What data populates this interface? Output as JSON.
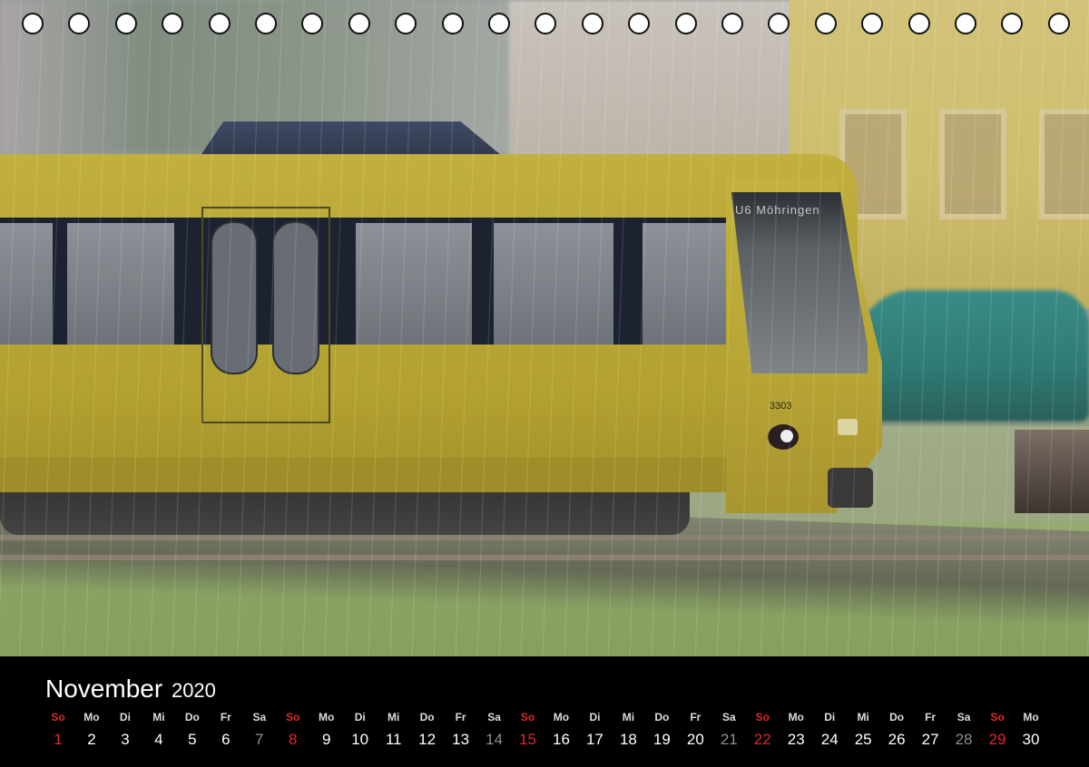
{
  "photo": {
    "destination_sign": "U6  Möhringen",
    "tram_number": "3303"
  },
  "binding_holes": 23,
  "calendar": {
    "month": "November",
    "year": "2020",
    "days": [
      {
        "dow": "So",
        "num": "1",
        "type": "sun"
      },
      {
        "dow": "Mo",
        "num": "2",
        "type": ""
      },
      {
        "dow": "Di",
        "num": "3",
        "type": ""
      },
      {
        "dow": "Mi",
        "num": "4",
        "type": ""
      },
      {
        "dow": "Do",
        "num": "5",
        "type": ""
      },
      {
        "dow": "Fr",
        "num": "6",
        "type": ""
      },
      {
        "dow": "Sa",
        "num": "7",
        "type": "muted"
      },
      {
        "dow": "So",
        "num": "8",
        "type": "sun"
      },
      {
        "dow": "Mo",
        "num": "9",
        "type": ""
      },
      {
        "dow": "Di",
        "num": "10",
        "type": ""
      },
      {
        "dow": "Mi",
        "num": "11",
        "type": ""
      },
      {
        "dow": "Do",
        "num": "12",
        "type": ""
      },
      {
        "dow": "Fr",
        "num": "13",
        "type": ""
      },
      {
        "dow": "Sa",
        "num": "14",
        "type": "muted"
      },
      {
        "dow": "So",
        "num": "15",
        "type": "sun"
      },
      {
        "dow": "Mo",
        "num": "16",
        "type": ""
      },
      {
        "dow": "Di",
        "num": "17",
        "type": ""
      },
      {
        "dow": "Mi",
        "num": "18",
        "type": ""
      },
      {
        "dow": "Do",
        "num": "19",
        "type": ""
      },
      {
        "dow": "Fr",
        "num": "20",
        "type": ""
      },
      {
        "dow": "Sa",
        "num": "21",
        "type": "muted"
      },
      {
        "dow": "So",
        "num": "22",
        "type": "sun"
      },
      {
        "dow": "Mo",
        "num": "23",
        "type": ""
      },
      {
        "dow": "Di",
        "num": "24",
        "type": ""
      },
      {
        "dow": "Mi",
        "num": "25",
        "type": ""
      },
      {
        "dow": "Do",
        "num": "26",
        "type": ""
      },
      {
        "dow": "Fr",
        "num": "27",
        "type": ""
      },
      {
        "dow": "Sa",
        "num": "28",
        "type": "muted"
      },
      {
        "dow": "So",
        "num": "29",
        "type": "sun"
      },
      {
        "dow": "Mo",
        "num": "30",
        "type": ""
      }
    ],
    "colors": {
      "sunday": "#e02828",
      "saturday_number": "#8f8f8f",
      "text": "#ffffff",
      "background": "#000000"
    }
  }
}
